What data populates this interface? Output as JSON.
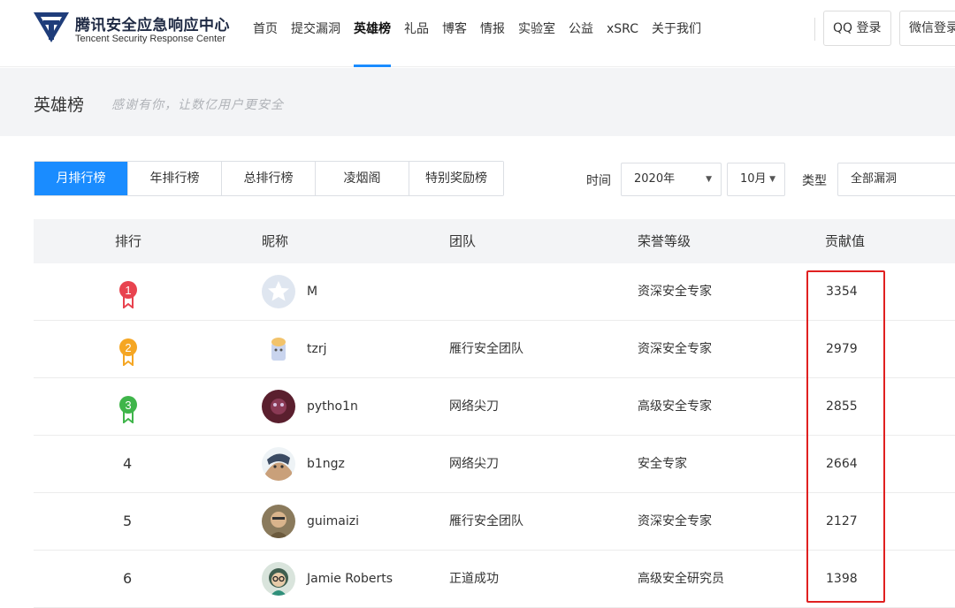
{
  "header": {
    "logo_cn": "腾讯安全应急响应中心",
    "logo_en": "Tencent Security Response Center",
    "nav": [
      "首页",
      "提交漏洞",
      "英雄榜",
      "礼品",
      "博客",
      "情报",
      "实验室",
      "公益",
      "xSRC",
      "关于我们"
    ],
    "active_nav_index": 2,
    "qq_login": "QQ 登录",
    "wechat_login": "微信登录"
  },
  "banner": {
    "title": "英雄榜",
    "subtitle": "感谢有你，让数亿用户更安全"
  },
  "tabs": [
    "月排行榜",
    "年排行榜",
    "总排行榜",
    "凌烟阁",
    "特别奖励榜"
  ],
  "active_tab_index": 0,
  "filters": {
    "time_label": "时间",
    "year": "2020年",
    "month": "10月",
    "type_label": "类型",
    "type_value": "全部漏洞"
  },
  "table": {
    "headers": [
      "排行",
      "昵称",
      "团队",
      "荣誉等级",
      "贡献值"
    ],
    "rows": [
      {
        "rank": "1",
        "medal": "red",
        "nickname": "M",
        "team": "",
        "level": "资深安全专家",
        "score": "3354"
      },
      {
        "rank": "2",
        "medal": "orange",
        "nickname": "tzrj",
        "team": "雁行安全团队",
        "level": "资深安全专家",
        "score": "2979"
      },
      {
        "rank": "3",
        "medal": "green",
        "nickname": "pytho1n",
        "team": "网络尖刀",
        "level": "高级安全专家",
        "score": "2855"
      },
      {
        "rank": "4",
        "medal": "",
        "nickname": "b1ngz",
        "team": "网络尖刀",
        "level": "安全专家",
        "score": "2664"
      },
      {
        "rank": "5",
        "medal": "",
        "nickname": "guimaizi",
        "team": "雁行安全团队",
        "level": "资深安全专家",
        "score": "2127"
      },
      {
        "rank": "6",
        "medal": "",
        "nickname": "Jamie Roberts",
        "team": "正道成功",
        "level": "高级安全研究员",
        "score": "1398"
      }
    ]
  },
  "colors": {
    "accent": "#1a8cff",
    "highlight": "#e02020",
    "medal_red": "#e8434f",
    "medal_orange": "#f5a623",
    "medal_green": "#3fb54a"
  }
}
